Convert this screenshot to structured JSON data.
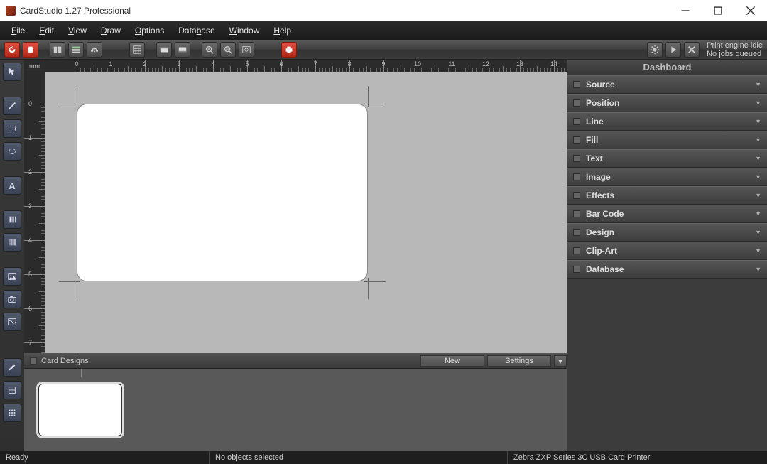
{
  "app": {
    "title": "CardStudio 1.27 Professional"
  },
  "menu": [
    "File",
    "Edit",
    "View",
    "Draw",
    "Options",
    "Database",
    "Window",
    "Help"
  ],
  "toolbar": {
    "buttons": [
      "refresh",
      "delete",
      "grid",
      "db-grid",
      "wifi",
      "spreadsheet",
      "undo",
      "redo",
      "zoom-in",
      "zoom-out",
      "fit",
      "print-red"
    ]
  },
  "print": {
    "line1": "Print engine idle",
    "line2": "No jobs queued"
  },
  "tools": [
    "pointer",
    "pencil",
    "rect-select",
    "ellipse",
    "text",
    "barcode",
    "barcode2d",
    "image",
    "camera",
    "effects",
    "line",
    "shape-cat",
    "list"
  ],
  "ruler": {
    "unit": "mm",
    "h_marks": [
      0,
      1,
      2,
      3,
      4,
      5,
      6,
      7,
      8,
      9,
      10,
      11,
      12,
      13,
      14
    ],
    "v_marks": [
      0,
      1,
      2,
      3,
      4,
      5,
      6
    ]
  },
  "card_designs": {
    "title": "Card Designs",
    "new": "New",
    "settings": "Settings"
  },
  "dashboard": {
    "title": "Dashboard",
    "sections": [
      "Source",
      "Position",
      "Line",
      "Fill",
      "Text",
      "Image",
      "Effects",
      "Bar Code",
      "Design",
      "Clip-Art",
      "Database"
    ]
  },
  "status": {
    "ready": "Ready",
    "selection": "No objects selected",
    "printer": "Zebra ZXP Series 3C USB Card Printer"
  }
}
